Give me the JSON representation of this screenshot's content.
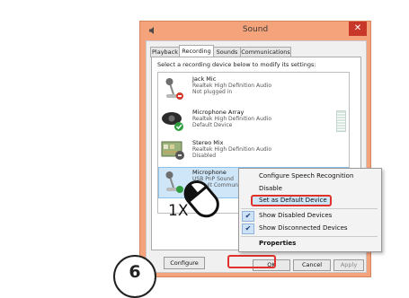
{
  "window": {
    "title": "Sound",
    "close_label": "✕"
  },
  "tabs": [
    "Playback",
    "Recording",
    "Sounds",
    "Communications"
  ],
  "active_tab": "Recording",
  "instruction": "Select a recording device below to modify its settings:",
  "devices": [
    {
      "name": "Jack Mic",
      "driver": "Realtek High Definition Audio",
      "status": "Not plugged in",
      "icon": "microphone-icon"
    },
    {
      "name": "Microphone Array",
      "driver": "Realtek High Definition Audio",
      "status": "Default Device",
      "icon": "webcam-icon"
    },
    {
      "name": "Stereo Mix",
      "driver": "Realtek High Definition Audio",
      "status": "Disabled",
      "icon": "sound-card-icon"
    },
    {
      "name": "Microphone",
      "driver": "USB PnP Sound",
      "status": "Default Commun",
      "icon": "microphone-icon"
    }
  ],
  "buttons": {
    "configure": "Configure",
    "ok": "OK",
    "cancel": "Cancel",
    "apply": "Apply"
  },
  "context_menu": {
    "items": [
      "Configure Speech Recognition",
      "Disable",
      "Set as Default Device",
      "Show Disabled Devices",
      "Show Disconnected Devices",
      "Properties"
    ],
    "checked": [
      "Show Disabled Devices",
      "Show Disconnected Devices"
    ],
    "highlighted": "Set as Default Device"
  },
  "annotation": {
    "step_number": "6",
    "click_count": "1X"
  },
  "colors": {
    "window_frame": "#f4a37a",
    "highlight": "#cfe6f8",
    "callout": "#e0312b"
  }
}
